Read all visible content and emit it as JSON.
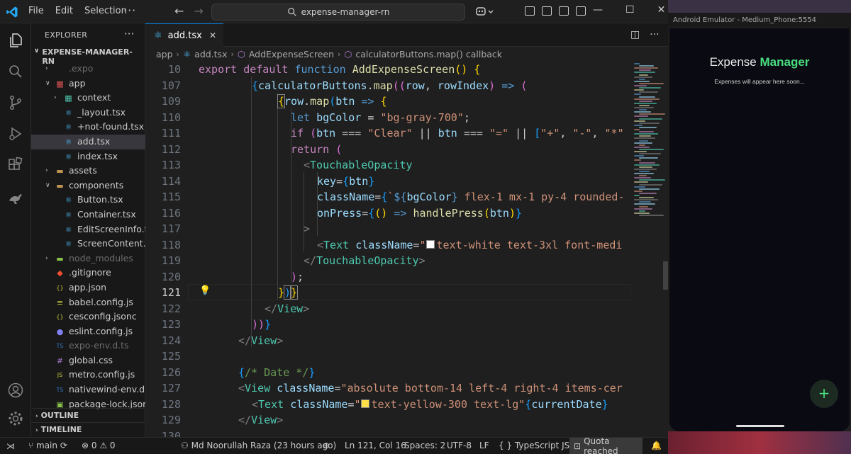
{
  "titlebar": {
    "menu": [
      "File",
      "Edit",
      "Selection"
    ],
    "search_text": "expense-manager-rn"
  },
  "explorer": {
    "heading": "EXPLORER",
    "project": "EXPENSE-MANAGER-RN",
    "items": [
      {
        "label": ".expo",
        "dimmed": true
      },
      {
        "label": "app"
      },
      {
        "label": "context"
      },
      {
        "label": "_layout.tsx"
      },
      {
        "label": "+not-found.tsx"
      },
      {
        "label": "add.tsx"
      },
      {
        "label": "index.tsx"
      },
      {
        "label": "assets"
      },
      {
        "label": "components"
      },
      {
        "label": "Button.tsx"
      },
      {
        "label": "Container.tsx"
      },
      {
        "label": "EditScreenInfo.tsx"
      },
      {
        "label": "ScreenContent.tsx"
      },
      {
        "label": "node_modules",
        "dimmed": true
      },
      {
        "label": ".gitignore"
      },
      {
        "label": "app.json"
      },
      {
        "label": "babel.config.js"
      },
      {
        "label": "cesconfig.jsonc"
      },
      {
        "label": "eslint.config.js"
      },
      {
        "label": "expo-env.d.ts",
        "dimmed": true
      },
      {
        "label": "global.css"
      },
      {
        "label": "metro.config.js"
      },
      {
        "label": "nativewind-env.d.ts"
      },
      {
        "label": "package-lock.json"
      }
    ],
    "outline": "OUTLINE",
    "timeline": "TIMELINE"
  },
  "editor": {
    "tab": "add.tsx",
    "breadcrumb": [
      "app",
      "add.tsx",
      "AddExpenseScreen",
      "calculatorButtons.map() callback"
    ],
    "line_numbers": [
      "10",
      "107",
      "109",
      "110",
      "111",
      "112",
      "113",
      "114",
      "115",
      "116",
      "117",
      "118",
      "119",
      "120",
      "121",
      "122",
      "123",
      "124",
      "125",
      "126",
      "127",
      "128",
      "129",
      "130"
    ],
    "current_line": "121"
  },
  "emulator": {
    "window_title": "Android Emulator - Medium_Phone:5554",
    "app_title_plain": "Expense ",
    "app_title_accent": "Manager",
    "empty_text": "Expenses will appear here soon...",
    "fab": "+"
  },
  "statusbar": {
    "branch": "main",
    "errors": "0",
    "warnings": "0",
    "author": "Md Noorullah Raza (23 hours ago)",
    "position": "Ln 121, Col 16",
    "spaces": "Spaces: 2",
    "encoding": "UTF-8",
    "eol": "LF",
    "language": "TypeScript JSX",
    "quota": "Quota reached"
  },
  "colors": {
    "accent": "#0078d4",
    "brand_green": "#4ade80",
    "editor_bg": "#1f1f1f"
  }
}
